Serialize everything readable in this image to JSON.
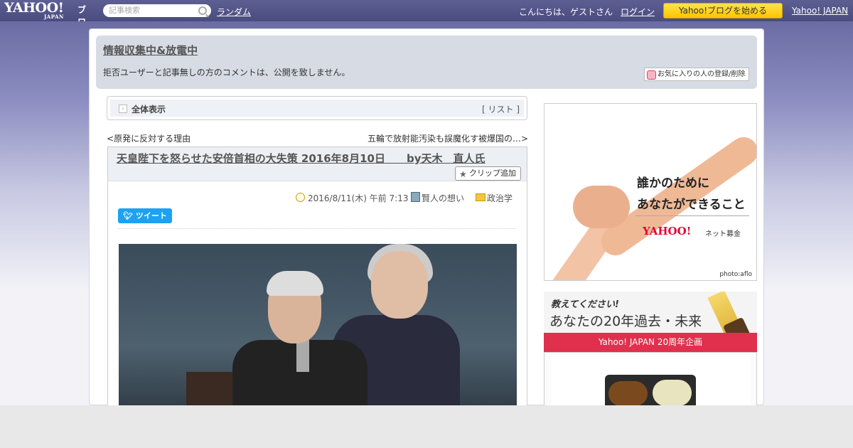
{
  "topbar": {
    "logo_main": "YAHOO!",
    "logo_sub": "JAPAN",
    "logo_service": "ブログ",
    "search_placeholder": "記事検索",
    "random_link": "ランダム",
    "greeting": "こんにちは、ゲストさん",
    "login_link": "ログイン",
    "start_button": "Yahoo!ブログを始める",
    "yahoo_japan_link": "Yahoo! JAPAN"
  },
  "blog_header": {
    "title": "情報収集中&放電中",
    "description": "拒否ユーザーと記事無しの方のコメントは、公開を致しません。",
    "favorite_button": "お気に入りの人の登録/削除"
  },
  "nav": {
    "all_display": "全体表示",
    "list_open": "[ ",
    "list_link": "リスト",
    "list_close": " ]",
    "prev_marker": "<",
    "prev_link": "原発に反対する理由",
    "next_link": "五輪で放射能汚染も誤魔化す被爆国の…",
    "next_marker": ">"
  },
  "article": {
    "title": "天皇陛下を怒らせた安倍首相の大失策 2016年8月10日　　by天木　直人氏",
    "clip_button": "クリップ追加",
    "date": "2016/8/11(木) 午前 7:13",
    "category1": "賢人の想い",
    "category2": "政治学",
    "tweet_button": "ツイート"
  },
  "sidebar": {
    "ad1_line1": "誰かのために",
    "ad1_line2": "あなたができること",
    "ad1_logo": "YAHOO!",
    "ad1_logo_sub": "ネット募金",
    "ad1_credit": "photo:aflo",
    "ad2_line1": "教えてください!",
    "ad2_line2": "あなたの20年過去・未来",
    "ad2_bar": "Yahoo! JAPAN 20周年企画"
  }
}
